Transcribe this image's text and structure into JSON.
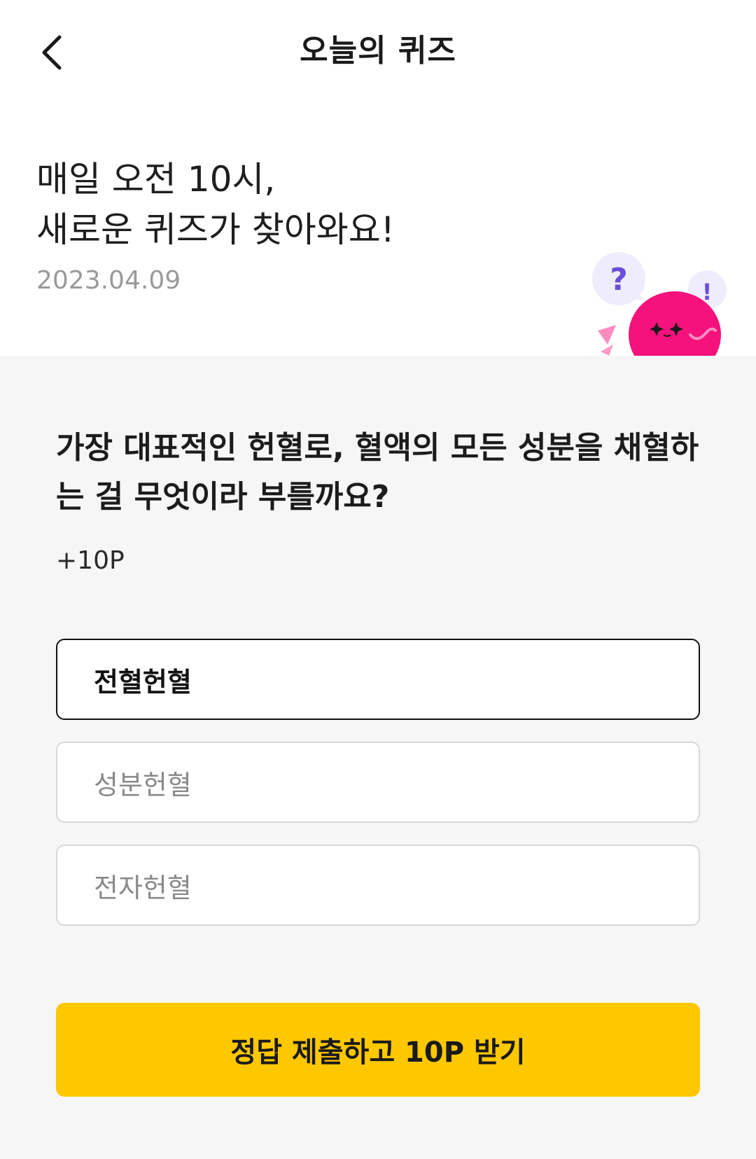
{
  "header": {
    "title": "오늘의 퀴즈",
    "back_icon": "chevron-left-icon"
  },
  "intro": {
    "line1": "매일 오전 10시,",
    "line2": "새로운 퀴즈가 찾아와요!",
    "date": "2023.04.09"
  },
  "mascot": {
    "question_mark": "?",
    "exclamation_mark": "!"
  },
  "quiz": {
    "question": "가장 대표적인 헌혈로, 혈액의 모든 성분을 채혈하는 걸 무엇이라 부를까요?",
    "points": "+10P",
    "options": [
      {
        "label": "전혈헌혈",
        "selected": true
      },
      {
        "label": "성분헌혈",
        "selected": false
      },
      {
        "label": "전자헌혈",
        "selected": false
      }
    ]
  },
  "submit": {
    "label": "정답 제출하고 10P 받기"
  },
  "colors": {
    "accent": "#fdc800",
    "mascot_pink": "#f5127c",
    "mascot_purple": "#6b4fd8",
    "background": "#f6f6f6"
  }
}
